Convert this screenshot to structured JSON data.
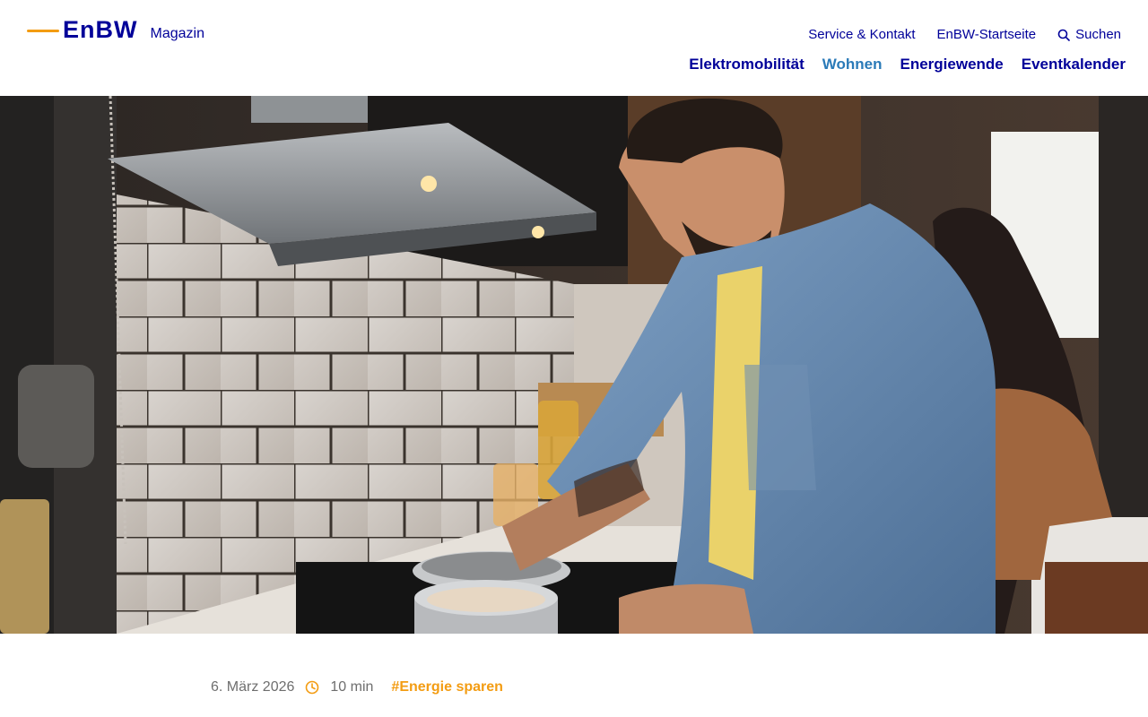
{
  "brand": {
    "logo_text": "EnBW",
    "section": "Magazin"
  },
  "utility_nav": {
    "service": "Service & Kontakt",
    "startseite": "EnBW-Startseite",
    "search": "Suchen"
  },
  "main_nav": [
    {
      "label": "Elektromobilität",
      "active": false
    },
    {
      "label": "Wohnen",
      "active": true
    },
    {
      "label": "Energiewende",
      "active": false
    },
    {
      "label": "Eventkalender",
      "active": false
    }
  ],
  "hero": {
    "icon": "hero-photo-man-cooking-kitchen"
  },
  "article_meta": {
    "date": "6. März 2026",
    "read_time": "10 min",
    "tag": "#Energie sparen"
  },
  "colors": {
    "brand_blue": "#000099",
    "accent_orange": "#f39c12",
    "active_nav": "#2a7ab8",
    "meta_grey": "#6e6e6e"
  }
}
